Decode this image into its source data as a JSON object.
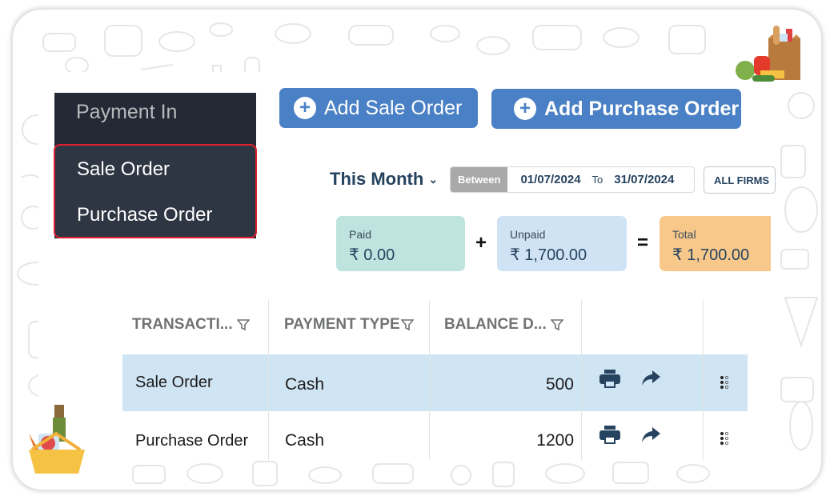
{
  "menu": {
    "header": "Payment In",
    "items": [
      {
        "label": "Sale Order"
      },
      {
        "label": "Purchase Order"
      }
    ]
  },
  "actions": {
    "add_sale_order": "Add Sale Order",
    "add_purchase_order": "Add Purchase Order"
  },
  "filters": {
    "period": "This Month",
    "range_label": "Between",
    "from_date": "01/07/2024",
    "to_label": "To",
    "to_date": "31/07/2024",
    "firm": "ALL FIRMS"
  },
  "summary": {
    "paid": {
      "label": "Paid",
      "value": "₹ 0.00",
      "color": "#bfe4df"
    },
    "plus": "+",
    "unpaid": {
      "label": "Unpaid",
      "value": "₹ 1,700.00",
      "color": "#cfe3f4"
    },
    "equals": "=",
    "total": {
      "label": "Total",
      "value": "₹ 1,700.00",
      "color": "#f8c88b"
    }
  },
  "table": {
    "columns": [
      "TRANSACTI...",
      "PAYMENT TYPE",
      "BALANCE D..."
    ],
    "rows": [
      {
        "transaction": "Sale Order",
        "payment_type": "Cash",
        "balance": "500",
        "selected": true
      },
      {
        "transaction": "Purchase Order",
        "payment_type": "Cash",
        "balance": "1200",
        "selected": false
      }
    ],
    "icons": {
      "print": "print-icon",
      "share": "share-icon",
      "more": "drag-handle-icon"
    }
  },
  "colors": {
    "brand_button": "#4a80c5",
    "menu_bg": "#232a35",
    "menu_highlight_border": "#e0202e",
    "selected_row": "#d0e5f4",
    "icon": "#26435f"
  }
}
